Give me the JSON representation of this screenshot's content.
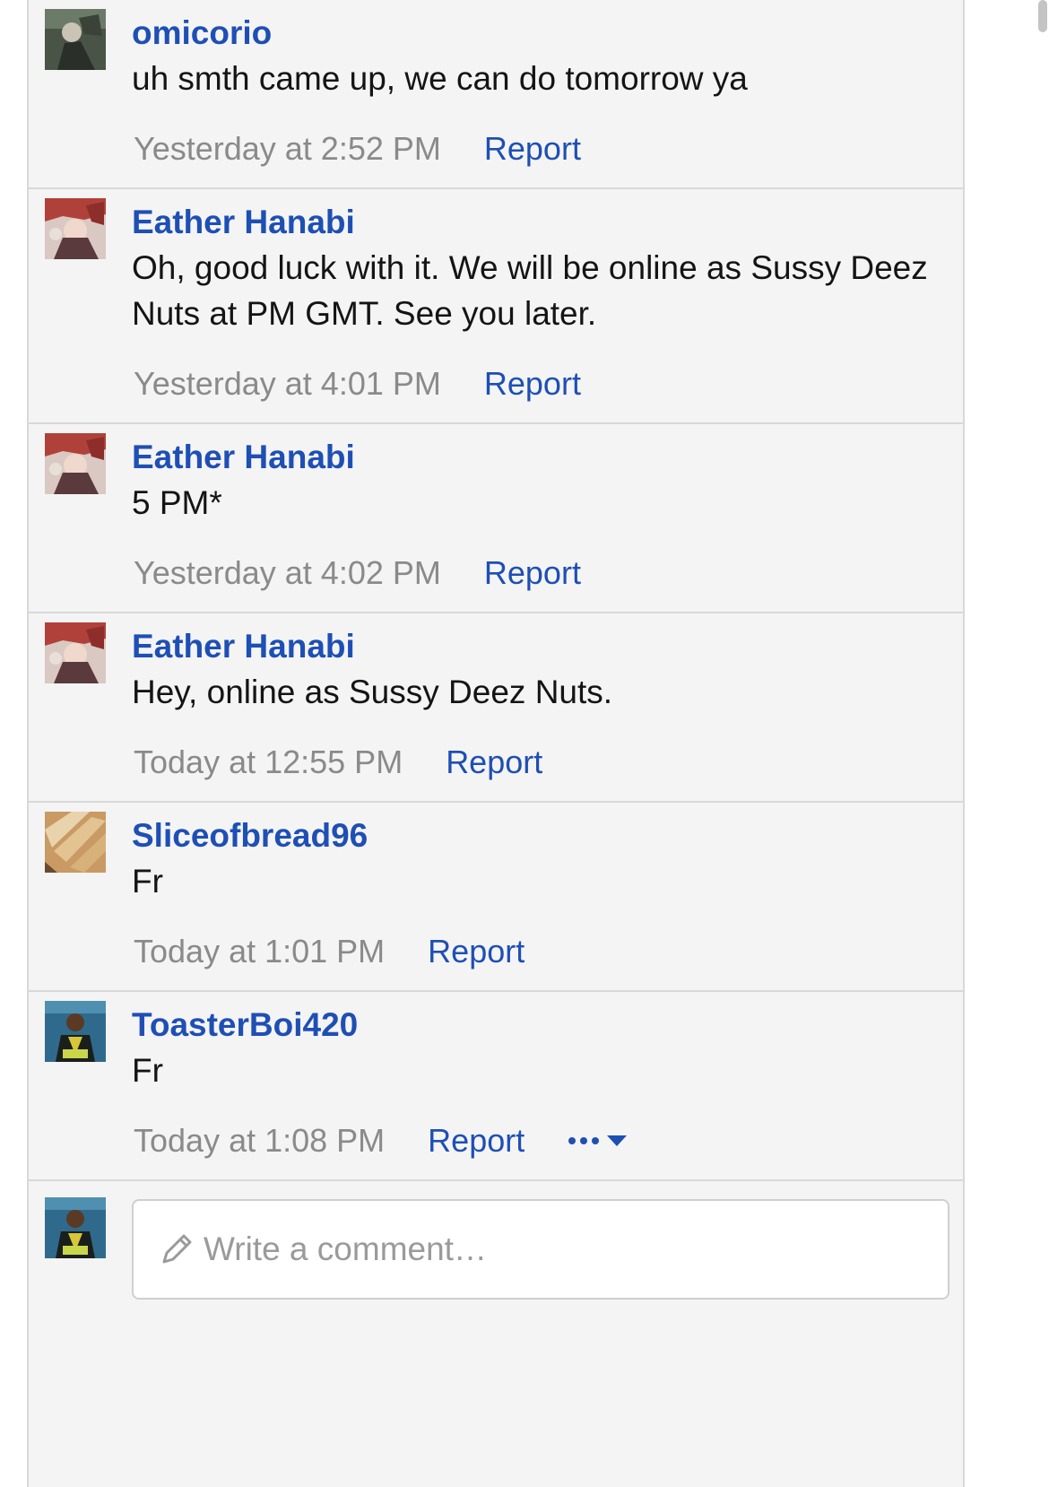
{
  "comments": [
    {
      "author": "omicorio",
      "avatar_icon": "user-avatar-dark-icon",
      "text": "uh smth came up, we can do tomorrow ya",
      "timestamp": "Yesterday at 2:52 PM",
      "report_label": "Report"
    },
    {
      "author": "Eather Hanabi",
      "avatar_icon": "user-avatar-anime-icon",
      "text": "Oh, good luck with it. We will be online as Sussy Deez Nuts at PM GMT. See you later.",
      "timestamp": "Yesterday at 4:01 PM",
      "report_label": "Report"
    },
    {
      "author": "Eather Hanabi",
      "avatar_icon": "user-avatar-anime-icon",
      "text": "5 PM*",
      "timestamp": "Yesterday at 4:02 PM",
      "report_label": "Report"
    },
    {
      "author": "Eather Hanabi",
      "avatar_icon": "user-avatar-anime-icon",
      "text": "Hey, online as Sussy Deez Nuts.",
      "timestamp": "Today at 12:55 PM",
      "report_label": "Report"
    },
    {
      "author": "Sliceofbread96",
      "avatar_icon": "user-avatar-bread-icon",
      "text": "Fr",
      "timestamp": "Today at 1:01 PM",
      "report_label": "Report"
    },
    {
      "author": "ToasterBoi420",
      "avatar_icon": "user-avatar-suit-icon",
      "text": "Fr",
      "timestamp": "Today at 1:08 PM",
      "report_label": "Report",
      "more_icon": "more-options-icon"
    }
  ],
  "composer": {
    "placeholder": "Write a comment…",
    "icon": "pencil-icon"
  },
  "colors": {
    "link": "#1e4fb4",
    "muted": "#8a8a8a",
    "panel": "#f4f4f4",
    "divider": "#d8d8d8"
  }
}
